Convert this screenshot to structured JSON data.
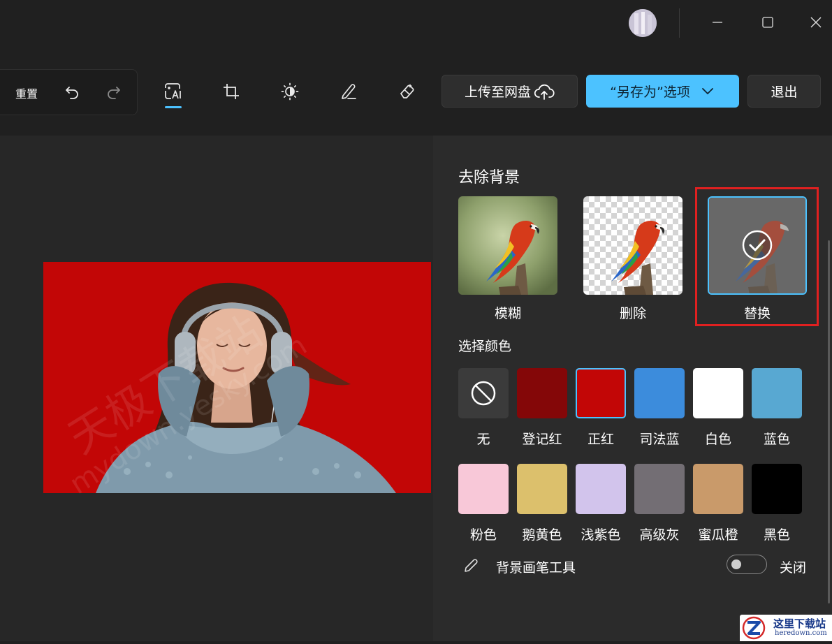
{
  "toolbar": {
    "reset_label": "重置",
    "upload_label": "上传至网盘",
    "save_as_label": "“另存为”选项",
    "exit_label": "退出",
    "accent": "#4cc2ff"
  },
  "panel": {
    "title": "去除背景",
    "options": [
      {
        "label": "模糊",
        "bg": "blur"
      },
      {
        "label": "删除",
        "bg": "transparent"
      },
      {
        "label": "替换",
        "bg": "replace",
        "selected": true
      }
    ],
    "color_section_label": "选择颜色",
    "swatches": [
      {
        "label": "无",
        "color": "none"
      },
      {
        "label": "登记红",
        "color": "#840708"
      },
      {
        "label": "正红",
        "color": "#c20606",
        "selected": true
      },
      {
        "label": "司法蓝",
        "color": "#3c8cdc"
      },
      {
        "label": "白色",
        "color": "#ffffff"
      },
      {
        "label": "蓝色",
        "color": "#58a8d2"
      },
      {
        "label": "粉色",
        "color": "#f8c8d8"
      },
      {
        "label": "鹅黄色",
        "color": "#dcc06c"
      },
      {
        "label": "浅紫色",
        "color": "#d2c4ec"
      },
      {
        "label": "高级灰",
        "color": "#736e74"
      },
      {
        "label": "蜜瓜橙",
        "color": "#c99a6a"
      },
      {
        "label": "黑色",
        "color": "#000000"
      }
    ],
    "brush_tool_label": "背景画笔工具",
    "toggle_state_label": "关闭",
    "toggle_on": false
  },
  "watermark": {
    "line1": "天极下载站",
    "line2": "mydown.yesky.com"
  },
  "corner_logo": {
    "title": "这里下载站",
    "url": "heredown.com"
  }
}
